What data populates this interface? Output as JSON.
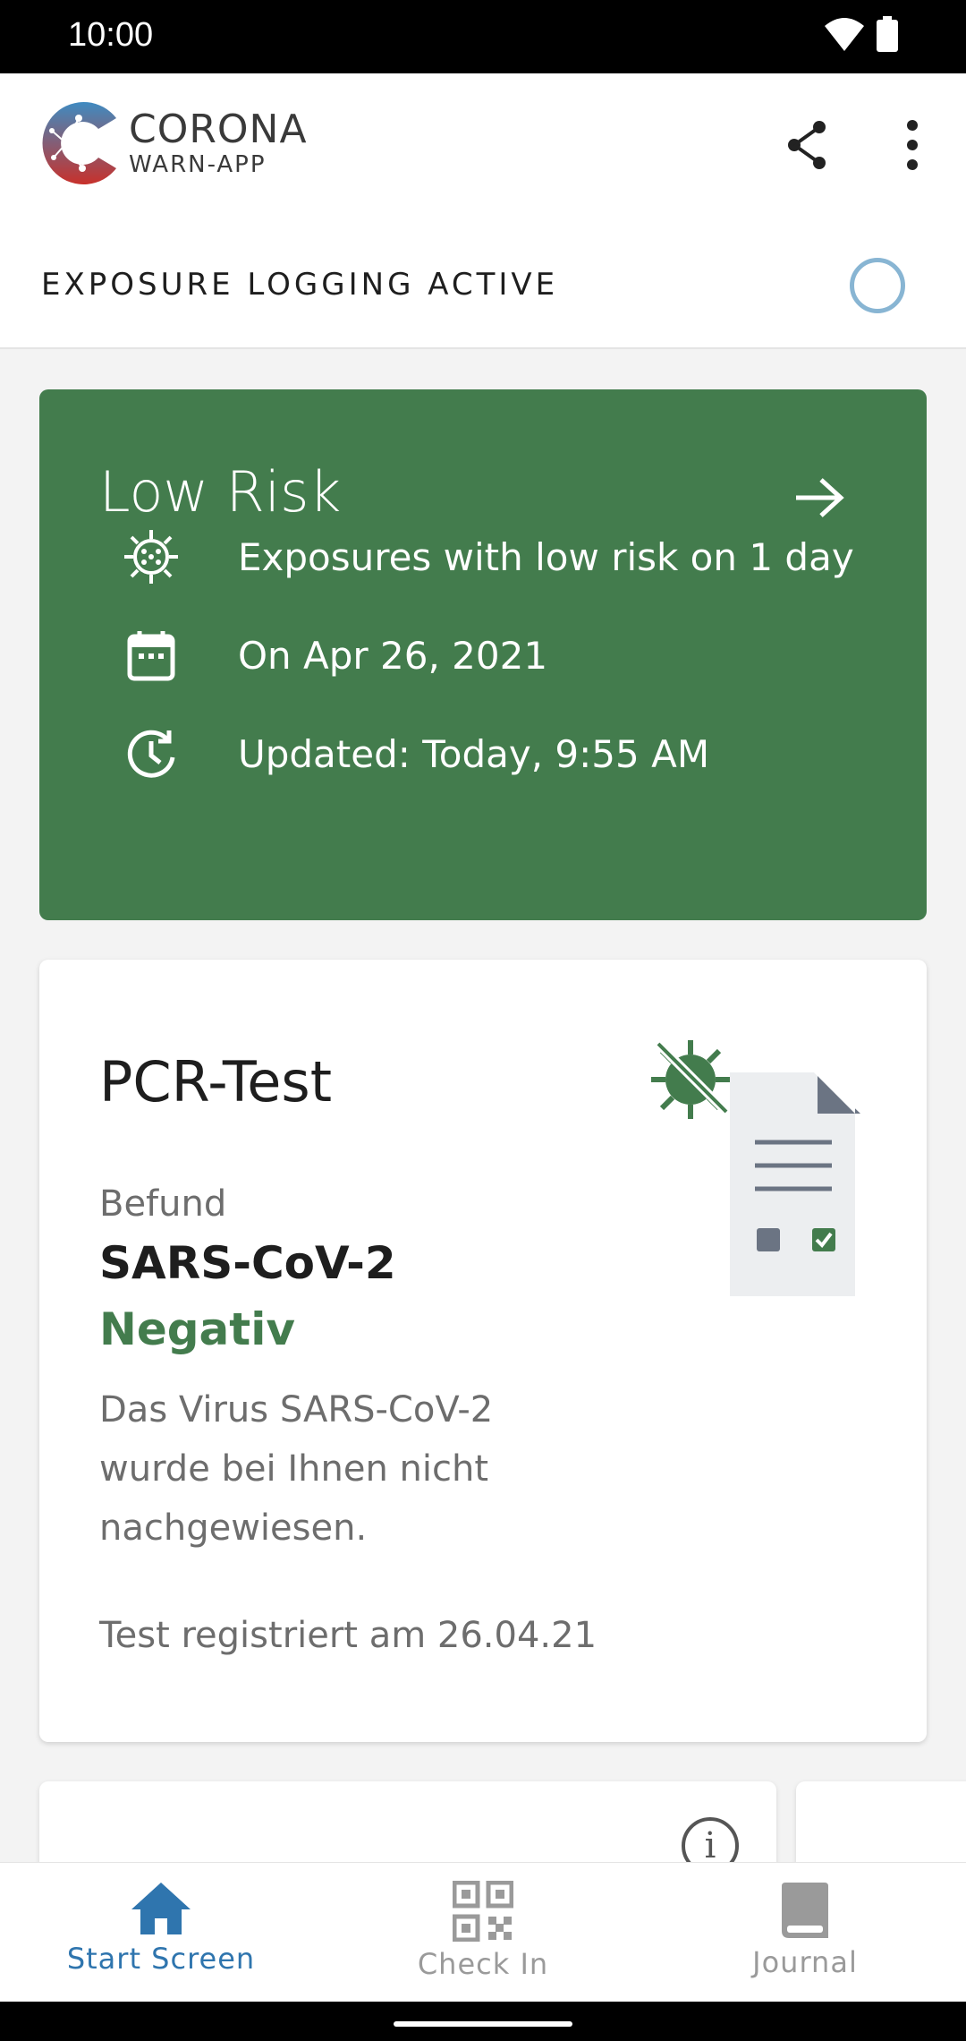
{
  "status_bar": {
    "time": "10:00"
  },
  "app": {
    "logo_title": "CORONA",
    "logo_subtitle": "WARN-APP"
  },
  "exposure": {
    "label": "EXPOSURE LOGGING ACTIVE"
  },
  "risk_card": {
    "title": "Low Risk",
    "rows": [
      {
        "icon": "virus-icon",
        "text": "Exposures with low risk on 1 day"
      },
      {
        "icon": "calendar-icon",
        "text": "On Apr 26, 2021"
      },
      {
        "icon": "clock-refresh-icon",
        "text": "Updated: Today, 9:55 AM"
      }
    ],
    "color": "#437c4d"
  },
  "pcr_card": {
    "title": "PCR-Test",
    "befund_label": "Befund",
    "virus": "SARS-CoV-2",
    "result": "Negativ",
    "description": "Das Virus SARS-CoV-2 wurde bei Ihnen nicht nachgewiesen.",
    "registered": "Test registriert am 26.04.21",
    "result_color": "#437c4d"
  },
  "bottom_nav": {
    "items": [
      {
        "label": "Start Screen",
        "icon": "home-icon",
        "active": true
      },
      {
        "label": "Check In",
        "icon": "qr-code-icon",
        "active": false
      },
      {
        "label": "Journal",
        "icon": "book-icon",
        "active": false
      }
    ],
    "accent": "#2f75ae"
  }
}
